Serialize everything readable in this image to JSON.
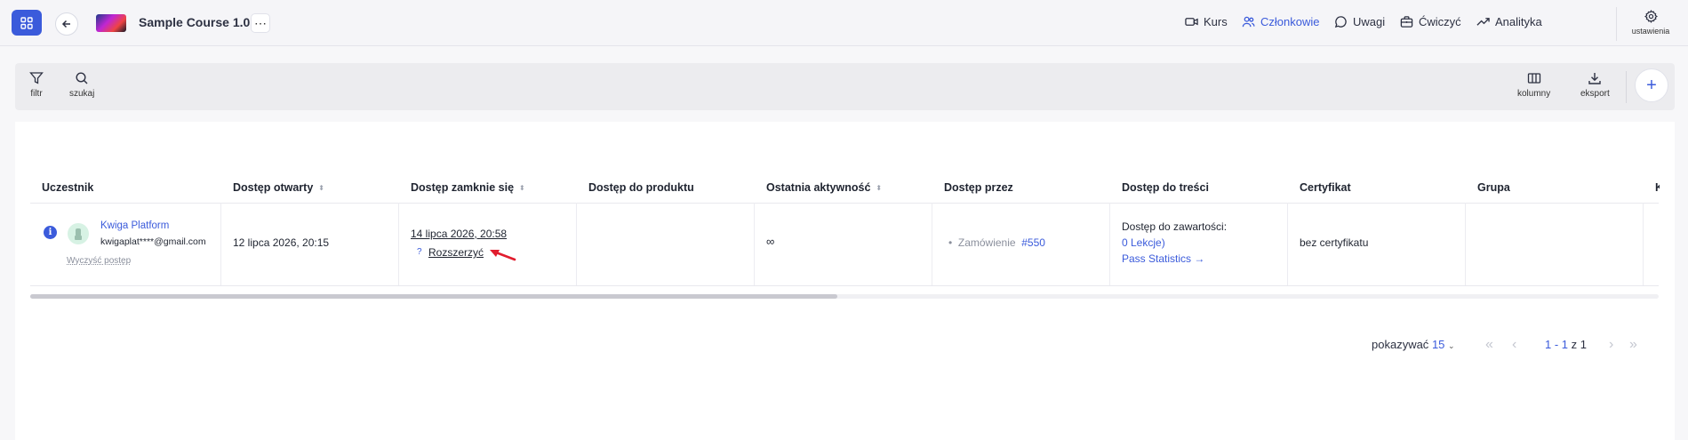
{
  "header": {
    "course_title": "Sample Course 1.0",
    "more_glyph": "⋯",
    "nav": [
      {
        "label": "Kurs",
        "icon": "video-icon",
        "active": false
      },
      {
        "label": "Członkowie",
        "icon": "users-icon",
        "active": true
      },
      {
        "label": "Uwagi",
        "icon": "comment-icon",
        "active": false
      },
      {
        "label": "Ćwiczyć",
        "icon": "briefcase-icon",
        "active": false
      },
      {
        "label": "Analityka",
        "icon": "trend-icon",
        "active": false
      }
    ],
    "settings_label": "ustawienia"
  },
  "toolbar": {
    "filter_label": "filtr",
    "search_label": "szukaj",
    "columns_label": "kolumny",
    "export_label": "eksport",
    "add_glyph": "+"
  },
  "table": {
    "headers": [
      "Uczestnik",
      "Dostęp otwarty",
      "Dostęp zamknie się",
      "Dostęp do produktu",
      "Ostatnia aktywność",
      "Dostęp przez",
      "Dostęp do treści",
      "Certyfikat",
      "Grupa",
      "K"
    ],
    "row": {
      "name": "Kwiga Platform",
      "email": "kwigaplat****@gmail.com",
      "clear_progress": "Wyczyść postęp",
      "access_opened": "12 lipca 2026, 20:15",
      "access_closes": "14 lipca 2026, 20:58",
      "extend_q": "?",
      "extend_label": "Rozszerzyć",
      "product_access": "",
      "last_activity": "∞",
      "access_via_prefix": "Zamówienie",
      "access_via_order": "#550",
      "content_access_title": "Dostęp do zawartości:",
      "content_access_lessons": "0 Lekcje)",
      "pass_statistics": "Pass Statistics →",
      "certificate": "bez certyfikatu",
      "group": ""
    }
  },
  "pagination": {
    "show_label": "pokazywać",
    "per_page": "15",
    "range": "1 - 1",
    "of_label": "z",
    "total": "1"
  },
  "colors": {
    "accent": "#3b5bdb",
    "annotation_arrow": "#e11d2e"
  }
}
